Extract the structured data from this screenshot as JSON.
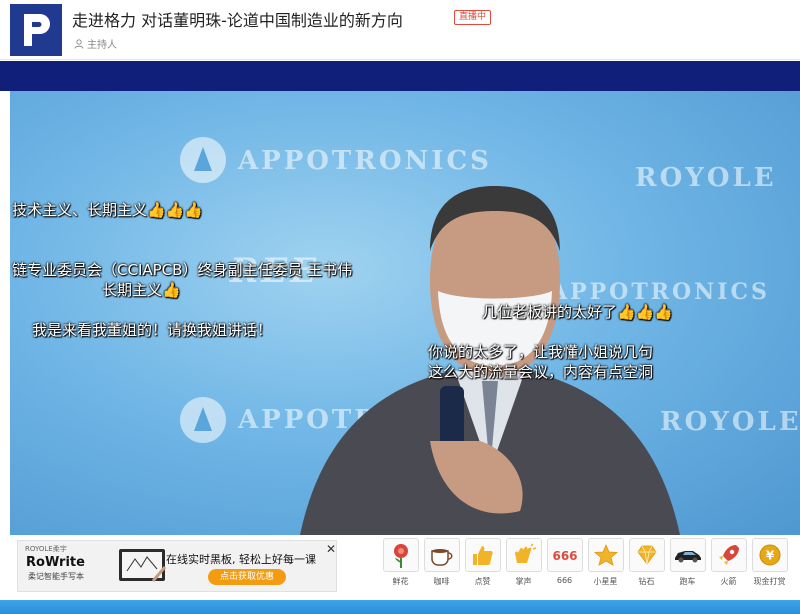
{
  "header": {
    "title": "走进格力 对话董明珠-论道中国制造业的新方向",
    "live_badge": "直播中",
    "host_label": "主持人"
  },
  "backdrop": {
    "brand1": "APPOTRONICS",
    "brand2": "ROYOLE",
    "brand3": "APPOTRONICS",
    "brand4": "ROYOLE",
    "brand5": "REE"
  },
  "danmu": [
    "技术主义、长期主义👍👍👍",
    "链专业委员会（CCIAPCB）终身副主任委员 王书伟",
    "长期主义👍",
    "我是来看我董姐的！请换我姐讲话！",
    "几位老板讲的太好了👍👍👍",
    "你说的太多了，让我懂小姐说几句",
    "这么大的流量会议，内容有点空洞"
  ],
  "ad": {
    "brand": "ROYOLE柔宇",
    "name": "RoWrite",
    "sub": "柔记智能手写本",
    "text": "在线实时黑板, 轻松上好每一课",
    "cta": "点击获取优惠"
  },
  "gifts": [
    {
      "label": "鲜花",
      "icon": "flower-icon",
      "color": "#d8453c"
    },
    {
      "label": "咖啡",
      "icon": "coffee-icon",
      "color": "#7a4a2a"
    },
    {
      "label": "点赞",
      "icon": "thumbs-up-icon",
      "color": "#f1b32a"
    },
    {
      "label": "掌声",
      "icon": "clap-icon",
      "color": "#f1b32a"
    },
    {
      "label": "666",
      "icon": "666-icon",
      "color": "#e0493b"
    },
    {
      "label": "小星星",
      "icon": "star-icon",
      "color": "#f1b32a"
    },
    {
      "label": "钻石",
      "icon": "diamond-icon",
      "color": "#f1b32a"
    },
    {
      "label": "跑车",
      "icon": "sports-car-icon",
      "color": "#222222"
    },
    {
      "label": "火箭",
      "icon": "rocket-icon",
      "color": "#d8453c"
    },
    {
      "label": "现金打赏",
      "icon": "cash-tip-icon",
      "color": "#e6a817"
    }
  ]
}
